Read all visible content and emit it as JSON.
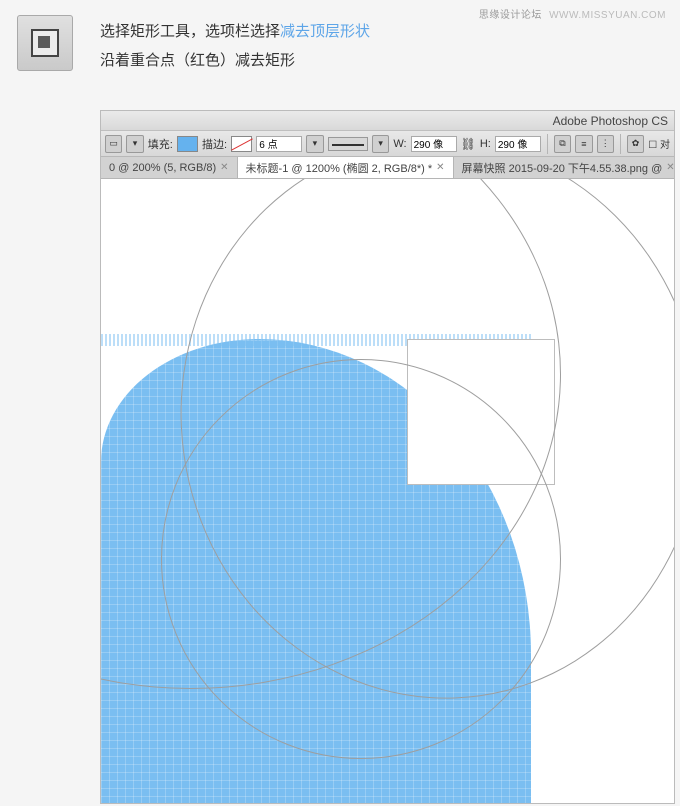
{
  "watermark": {
    "site": "思缘设计论坛",
    "url": "WWW.MISSYUAN.COM"
  },
  "instructions": {
    "line1_prefix": "选择矩形工具，选项栏选择",
    "line1_highlight": "减去顶层形状",
    "line2": "沿着重合点（红色）减去矩形"
  },
  "ps": {
    "title": "Adobe Photoshop CS",
    "toolbar": {
      "fill_label": "填充:",
      "stroke_label": "描边:",
      "stroke_points": "6 点",
      "w_label": "W:",
      "w_value": "290 像",
      "h_label": "H:",
      "h_value": "290 像",
      "align_checkbox": "对"
    },
    "tabs": {
      "tab1": "0 @ 200% (5, RGB/8)",
      "tab2": "未标题-1 @ 1200% (椭圆 2, RGB/8*) *",
      "tab3": "屏幕快照 2015-09-20 下午4.55.38.png @"
    }
  }
}
